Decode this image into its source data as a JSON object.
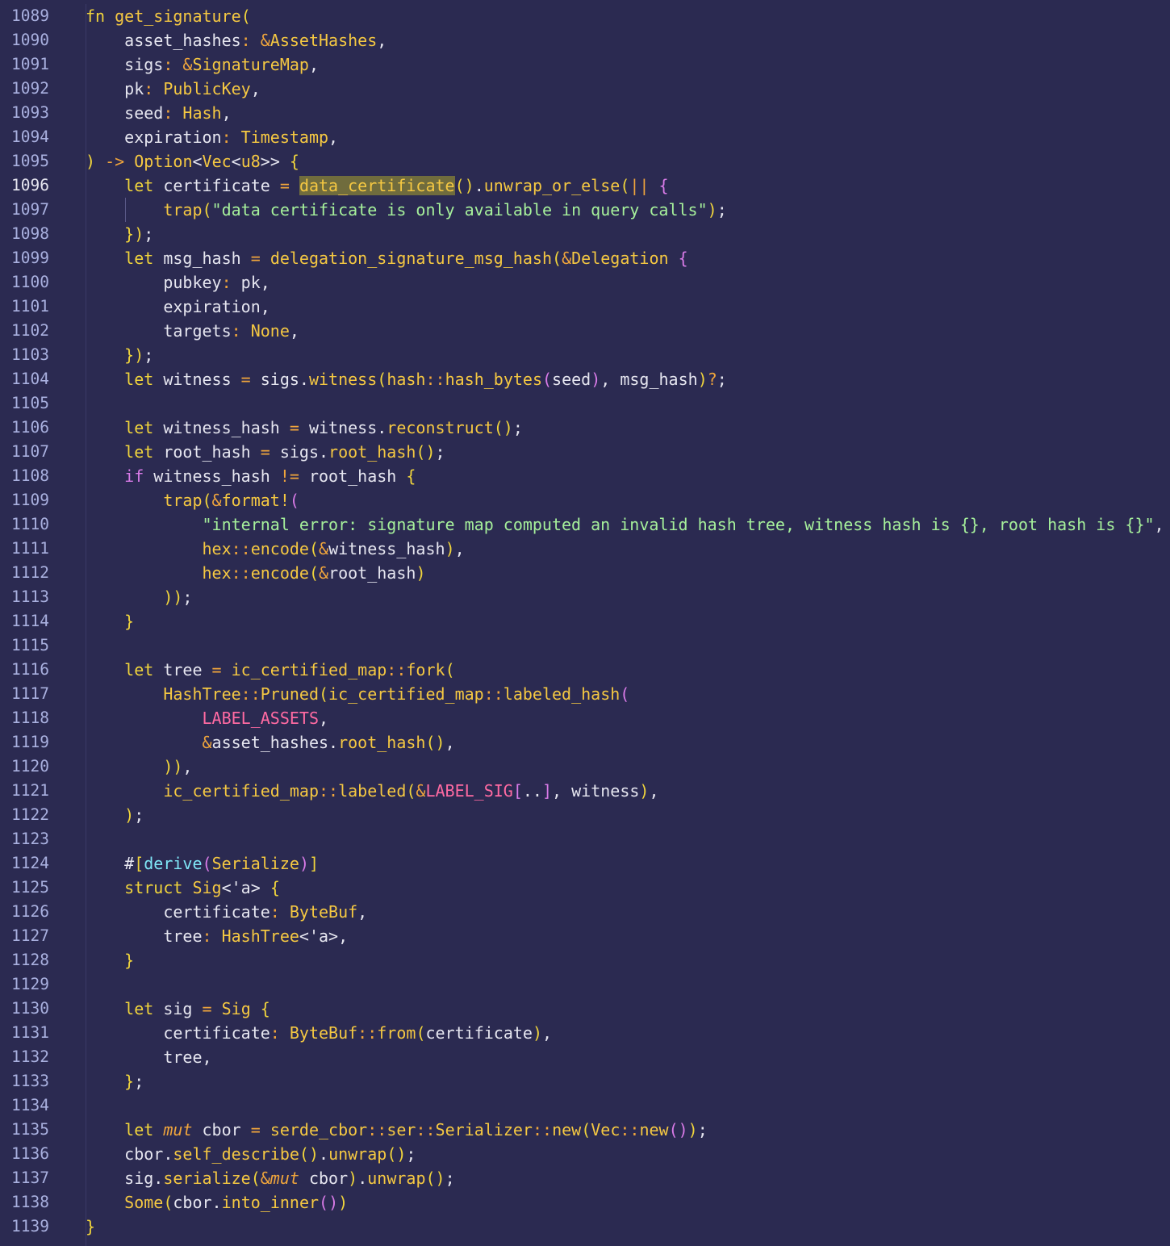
{
  "editor": {
    "language": "rust",
    "active_line": 1096,
    "highlighted_word": "data_certificate",
    "colors": {
      "background": "#2b2a51",
      "line_number": "#a9b0df",
      "keyword": "#f0d43c",
      "type": "#f5c842",
      "string": "#a6f09b",
      "operator": "#f0a53c",
      "constant": "#ff6aa2",
      "attribute": "#7fe7f7"
    },
    "lines": [
      {
        "n": "1089",
        "t": "fn get_signature("
      },
      {
        "n": "1090",
        "t": "    asset_hashes: &AssetHashes,"
      },
      {
        "n": "1091",
        "t": "    sigs: &SignatureMap,"
      },
      {
        "n": "1092",
        "t": "    pk: PublicKey,"
      },
      {
        "n": "1093",
        "t": "    seed: Hash,"
      },
      {
        "n": "1094",
        "t": "    expiration: Timestamp,"
      },
      {
        "n": "1095",
        "t": ") -> Option<Vec<u8>> {"
      },
      {
        "n": "1096",
        "t": "    let certificate = data_certificate().unwrap_or_else(|| {"
      },
      {
        "n": "1097",
        "t": "        trap(\"data certificate is only available in query calls\");"
      },
      {
        "n": "1098",
        "t": "    });"
      },
      {
        "n": "1099",
        "t": "    let msg_hash = delegation_signature_msg_hash(&Delegation {"
      },
      {
        "n": "1100",
        "t": "        pubkey: pk,"
      },
      {
        "n": "1101",
        "t": "        expiration,"
      },
      {
        "n": "1102",
        "t": "        targets: None,"
      },
      {
        "n": "1103",
        "t": "    });"
      },
      {
        "n": "1104",
        "t": "    let witness = sigs.witness(hash::hash_bytes(seed), msg_hash)?;"
      },
      {
        "n": "1105",
        "t": ""
      },
      {
        "n": "1106",
        "t": "    let witness_hash = witness.reconstruct();"
      },
      {
        "n": "1107",
        "t": "    let root_hash = sigs.root_hash();"
      },
      {
        "n": "1108",
        "t": "    if witness_hash != root_hash {"
      },
      {
        "n": "1109",
        "t": "        trap(&format!("
      },
      {
        "n": "1110",
        "t": "            \"internal error: signature map computed an invalid hash tree, witness hash is {}, root hash is {}\","
      },
      {
        "n": "1111",
        "t": "            hex::encode(&witness_hash),"
      },
      {
        "n": "1112",
        "t": "            hex::encode(&root_hash)"
      },
      {
        "n": "1113",
        "t": "        ));"
      },
      {
        "n": "1114",
        "t": "    }"
      },
      {
        "n": "1115",
        "t": ""
      },
      {
        "n": "1116",
        "t": "    let tree = ic_certified_map::fork("
      },
      {
        "n": "1117",
        "t": "        HashTree::Pruned(ic_certified_map::labeled_hash("
      },
      {
        "n": "1118",
        "t": "            LABEL_ASSETS,"
      },
      {
        "n": "1119",
        "t": "            &asset_hashes.root_hash(),"
      },
      {
        "n": "1120",
        "t": "        )),"
      },
      {
        "n": "1121",
        "t": "        ic_certified_map::labeled(&LABEL_SIG[..], witness),"
      },
      {
        "n": "1122",
        "t": "    );"
      },
      {
        "n": "1123",
        "t": ""
      },
      {
        "n": "1124",
        "t": "    #[derive(Serialize)]"
      },
      {
        "n": "1125",
        "t": "    struct Sig<'a> {"
      },
      {
        "n": "1126",
        "t": "        certificate: ByteBuf,"
      },
      {
        "n": "1127",
        "t": "        tree: HashTree<'a>,"
      },
      {
        "n": "1128",
        "t": "    }"
      },
      {
        "n": "1129",
        "t": ""
      },
      {
        "n": "1130",
        "t": "    let sig = Sig {"
      },
      {
        "n": "1131",
        "t": "        certificate: ByteBuf::from(certificate),"
      },
      {
        "n": "1132",
        "t": "        tree,"
      },
      {
        "n": "1133",
        "t": "    };"
      },
      {
        "n": "1134",
        "t": ""
      },
      {
        "n": "1135",
        "t": "    let mut cbor = serde_cbor::ser::Serializer::new(Vec::new());"
      },
      {
        "n": "1136",
        "t": "    cbor.self_describe().unwrap();"
      },
      {
        "n": "1137",
        "t": "    sig.serialize(&mut cbor).unwrap();"
      },
      {
        "n": "1138",
        "t": "    Some(cbor.into_inner())"
      },
      {
        "n": "1139",
        "t": "}"
      }
    ]
  }
}
